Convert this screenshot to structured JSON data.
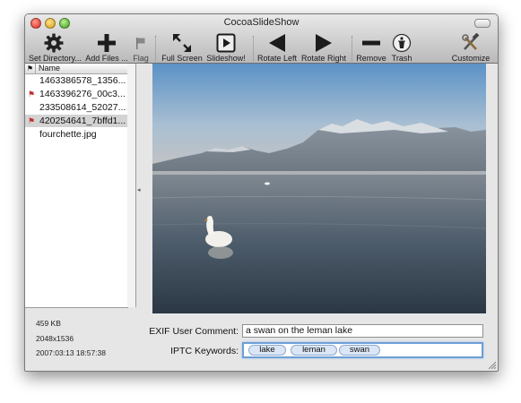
{
  "window": {
    "title": "CocoaSlideShow"
  },
  "toolbar": {
    "set_directory": "Set Directory...",
    "add_files": "Add Files ...",
    "flag": "Flag",
    "full_screen": "Full Screen",
    "slideshow": "Slideshow!",
    "rotate_left": "Rotate Left",
    "rotate_right": "Rotate Right",
    "remove": "Remove",
    "trash": "Trash",
    "customize": "Customize"
  },
  "file_list": {
    "flag_column_header": "⚑",
    "name_column_header": "Name",
    "files": [
      {
        "name": "1463386578_1356...",
        "flag_icon": "",
        "selected": false
      },
      {
        "name": "1463396276_00c3...",
        "flag_icon": "red-flag-icon",
        "selected": false
      },
      {
        "name": "233508614_52027...",
        "flag_icon": "",
        "selected": false
      },
      {
        "name": "420254641_7bffd1...",
        "flag_icon": "red-flag-icon",
        "selected": true
      },
      {
        "name": "fourchette.jpg",
        "flag_icon": "",
        "selected": false
      }
    ]
  },
  "image_info": {
    "file_size": "459 KB",
    "dimensions": "2048x1536",
    "date": "2007:03:13 18:57:38"
  },
  "metadata": {
    "exif_label": "EXIF User Comment:",
    "exif_value": "a swan on the leman lake",
    "iptc_label": "IPTC Keywords:",
    "keywords": [
      "lake",
      "leman",
      "swan"
    ]
  },
  "colors": {
    "selection": "#d3d3d3",
    "focus_ring": "#6d9fd6",
    "token_fill": "#dbe6f5",
    "flag_red": "#c03030"
  }
}
